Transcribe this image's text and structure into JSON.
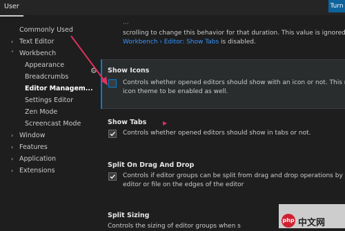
{
  "header": {
    "tab_user": "User",
    "button_label": "Turn"
  },
  "tree": {
    "commonly_used": "Commonly Used",
    "text_editor": "Text Editor",
    "workbench": "Workbench",
    "appearance": "Appearance",
    "breadcrumbs": "Breadcrumbs",
    "editor_management": "Editor Managem...",
    "settings_editor": "Settings Editor",
    "zen_mode": "Zen Mode",
    "screencast_mode": "Screencast Mode",
    "window": "Window",
    "features": "Features",
    "application": "Application",
    "extensions": "Extensions"
  },
  "top_partial": {
    "line1": "scrolling to change this behavior for that duration. This value is ignored",
    "link": "Workbench › Editor: Show Tabs",
    "suffix": " is disabled."
  },
  "settings": [
    {
      "title": "Show Icons",
      "line1": "Controls whether opened editors should show with an icon or not. This r",
      "line2": "icon theme to be enabled as well.",
      "checked": false
    },
    {
      "title": "Show Tabs",
      "line1": "Controls whether opened editors should show in tabs or not.",
      "checked": true
    },
    {
      "title": "Split On Drag And Drop",
      "line1": "Controls if editor groups can be split from drag and drop operations by",
      "line2": "editor or file on the edges of the editor",
      "checked": true
    },
    {
      "title": "Split Sizing",
      "line1": "Controls the sizing of editor groups when s"
    }
  ],
  "watermark": {
    "text": "中文网",
    "badge": "php"
  },
  "colors": {
    "accent": "#007fd4",
    "annotation_arrow": "#e0315e"
  }
}
